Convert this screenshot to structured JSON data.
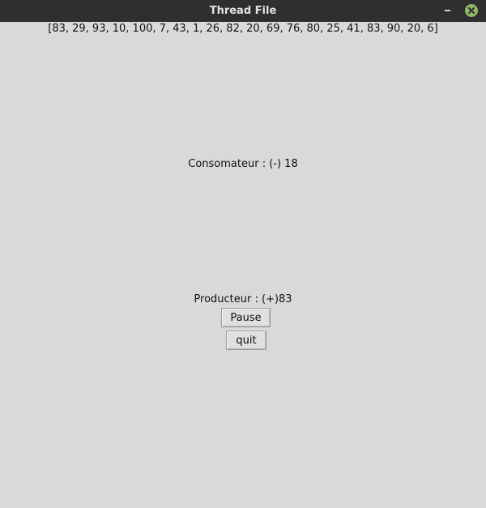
{
  "window": {
    "title": "Thread File",
    "accent_color": "#8fb666"
  },
  "queue": {
    "text": "[83, 29, 93, 10, 100, 7, 43, 1, 26, 82, 20, 69, 76, 80, 25, 41, 83, 90, 20, 6]"
  },
  "consumer": {
    "text": "Consomateur : (-) 18"
  },
  "producer": {
    "text": "Producteur : (+)83"
  },
  "buttons": {
    "pause_label": "Pause",
    "quit_label": "quit"
  },
  "icons": {
    "minimize": "minimize-icon",
    "close": "close-icon"
  }
}
